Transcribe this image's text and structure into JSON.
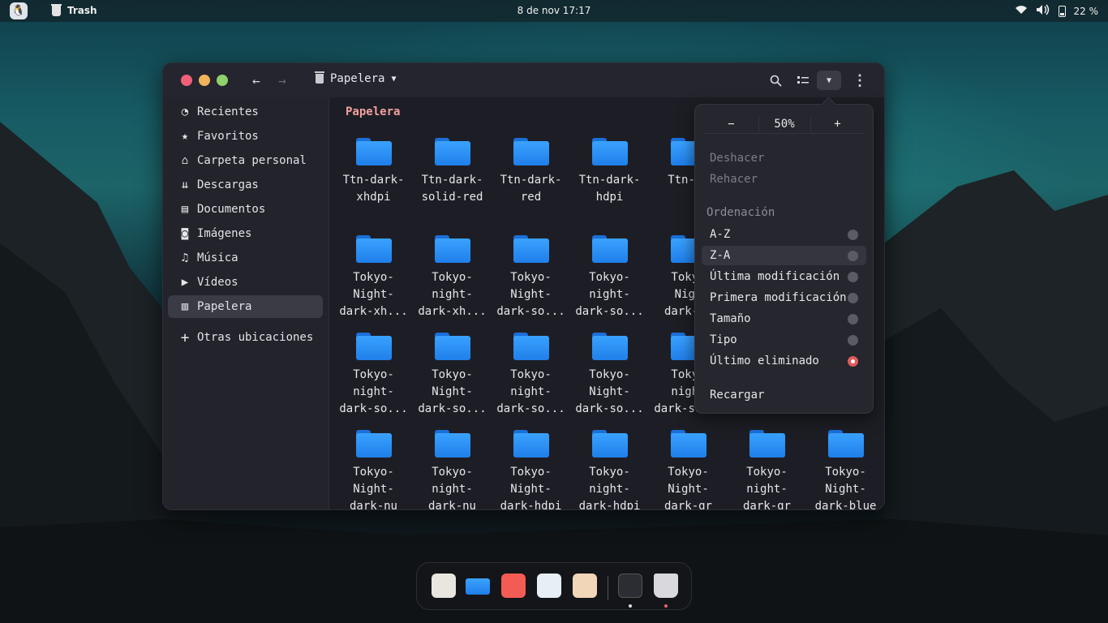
{
  "topbar": {
    "app_name": "Trash",
    "clock": "8 de nov 17:17",
    "battery": "22 %"
  },
  "window": {
    "title": "Papelera",
    "accent": "#f2a0a0"
  },
  "sidebar": {
    "items": [
      {
        "label": "Recientes",
        "icon": "clock-icon"
      },
      {
        "label": "Favoritos",
        "icon": "star-icon"
      },
      {
        "label": "Carpeta personal",
        "icon": "home-icon"
      },
      {
        "label": "Descargas",
        "icon": "download-icon"
      },
      {
        "label": "Documentos",
        "icon": "document-icon"
      },
      {
        "label": "Imágenes",
        "icon": "camera-icon"
      },
      {
        "label": "Música",
        "icon": "music-icon"
      },
      {
        "label": "Vídeos",
        "icon": "video-icon"
      },
      {
        "label": "Papelera",
        "icon": "trash-icon"
      },
      {
        "label": "Otras ubicaciones",
        "icon": "plus-icon"
      }
    ]
  },
  "content": {
    "breadcrumb": "Papelera",
    "row1": [
      [
        "Ttn-dark-",
        "xhdpi"
      ],
      [
        "Ttn-dark-",
        "solid-red"
      ],
      [
        "Ttn-dark-",
        "red"
      ],
      [
        "Ttn-dark-",
        "hdpi"
      ],
      [
        "Ttn-da"
      ]
    ],
    "row2": [
      [
        "Tokyo-",
        "Night-",
        "dark-xh..."
      ],
      [
        "Tokyo-",
        "night-",
        "dark-xh..."
      ],
      [
        "Tokyo-",
        "Night-",
        "dark-so..."
      ],
      [
        "Tokyo-",
        "night-",
        "dark-so..."
      ],
      [
        "Tokyo",
        "Nigh",
        "dark-so"
      ]
    ],
    "row3": [
      [
        "Tokyo-",
        "night-",
        "dark-so..."
      ],
      [
        "Tokyo-",
        "Night-",
        "dark-so..."
      ],
      [
        "Tokyo-",
        "night-",
        "dark-so..."
      ],
      [
        "Tokyo-",
        "Night-",
        "dark-so..."
      ],
      [
        "Tokyo",
        "night",
        "dark-so..."
      ]
    ],
    "row4": [
      [
        "Tokyo-",
        "Night-",
        "dark-nu"
      ],
      [
        "Tokyo-",
        "night-",
        "dark-nu"
      ],
      [
        "Tokyo-",
        "Night-",
        "dark-hdpi"
      ],
      [
        "Tokyo-",
        "night-",
        "dark-hdpi"
      ],
      [
        "Tokyo-",
        "Night-",
        "dark-gr"
      ],
      [
        "Tokyo-",
        "night-",
        "dark-gr"
      ],
      [
        "Tokyo-",
        "Night-",
        "dark-blue"
      ]
    ]
  },
  "menu": {
    "zoom_minus": "−",
    "zoom_value": "50%",
    "zoom_plus": "+",
    "undo": "Deshacer",
    "redo": "Rehacer",
    "sort_header": "Ordenación",
    "sort_options": [
      "A-Z",
      "Z-A",
      "Última modificación",
      "Primera modificación",
      "Tamaño",
      "Tipo",
      "Último eliminado"
    ],
    "selected_sort": "Último eliminado",
    "reload": "Recargar"
  }
}
